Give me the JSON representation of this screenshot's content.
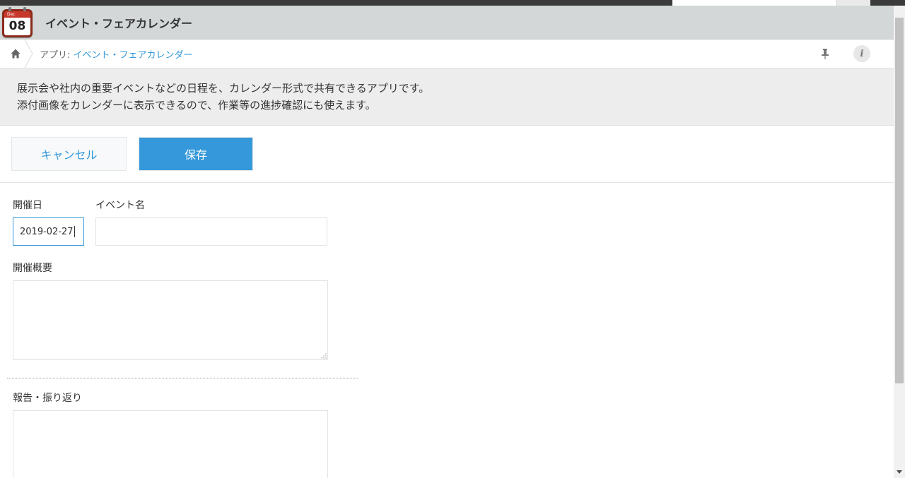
{
  "app": {
    "icon_month": "Dec",
    "icon_day": "08",
    "title": "イベント・フェアカレンダー"
  },
  "breadcrumb": {
    "prefix": "アプリ: ",
    "app_link": "イベント・フェアカレンダー"
  },
  "description": {
    "line1": "展示会や社内の重要イベントなどの日程を、カレンダー形式で共有できるアプリです。",
    "line2": "添付画像をカレンダーに表示できるので、作業等の進捗確認にも使えます。"
  },
  "actions": {
    "cancel_label": "キャンセル",
    "save_label": "保存"
  },
  "form": {
    "date_label": "開催日",
    "date_value": "2019-02-27",
    "event_name_label": "イベント名",
    "event_name_value": "",
    "summary_label": "開催概要",
    "summary_value": "",
    "report_label": "報告・振り返り",
    "report_value": ""
  },
  "colors": {
    "accent": "#3498db",
    "header_bg": "#d4d7d8",
    "description_bg": "#ededed"
  },
  "icons": {
    "home": "home-icon",
    "pin": "pin-icon",
    "info": "info-icon"
  }
}
